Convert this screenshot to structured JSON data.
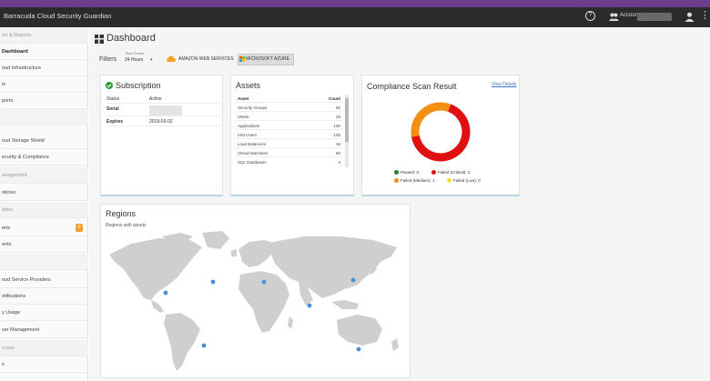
{
  "window": {
    "app_title": "Barracuda Cloud Security Guardian",
    "account_label": "Account",
    "help_icon": "question-circle-icon",
    "account_icon": "users-icon",
    "user_icon": "user-icon",
    "menu_icon": "kebab-menu-icon",
    "colors": {
      "accent_strip": "#6b3d8f",
      "topbar": "#2b2b2b"
    }
  },
  "sidebar": {
    "items": [
      {
        "label": "ert & Reports",
        "header": true
      },
      {
        "label": "Dashboard",
        "active": true
      },
      {
        "label": "oud Infrastructure"
      },
      {
        "label": "ts"
      },
      {
        "label": "ports"
      },
      {
        "label": "",
        "header": true
      },
      {
        "label": "oud Storage Shield"
      },
      {
        "label": "ecurity & Compliance"
      },
      {
        "label": "anagement",
        "header": true
      },
      {
        "label": "olicies"
      },
      {
        "label": "ation",
        "header": true
      },
      {
        "label": "erts",
        "badge": "0"
      },
      {
        "label": "ents"
      },
      {
        "label": "",
        "header": true
      },
      {
        "label": "oud Service Providers"
      },
      {
        "label": "otifications"
      },
      {
        "label": "y Usage"
      },
      {
        "label": "ser Management"
      },
      {
        "label": "ccess",
        "header": true
      },
      {
        "label": "s"
      }
    ]
  },
  "dashboard": {
    "title": "Dashboard",
    "filters_label": "Filters",
    "timeframe_caption": "Time Frame",
    "timeframe_value": "24 Hours",
    "aws_label": "AMAZON WEB SERVICES",
    "azure_label": "MICROSOFT AZURE"
  },
  "subscription": {
    "title": "Subscription",
    "status_icon": "check-circle-icon",
    "rows": [
      {
        "key": "Status",
        "value": "Active"
      },
      {
        "key": "Serial",
        "value": ""
      },
      {
        "key": "Expires",
        "value": "2019-03-02"
      }
    ]
  },
  "assets": {
    "title": "Assets",
    "header": {
      "name": "Asset",
      "count": "Count"
    },
    "rows": [
      {
        "name": "Security Groups",
        "count": "92"
      },
      {
        "name": "VNets",
        "count": "29"
      },
      {
        "name": "Applications",
        "count": "100"
      },
      {
        "name": "IAM Users",
        "count": "100"
      },
      {
        "name": "Load Balancers",
        "count": "16"
      },
      {
        "name": "Virtual Machines",
        "count": "50"
      },
      {
        "name": "SQL Databases",
        "count": "4"
      }
    ]
  },
  "compliance": {
    "title": "Compliance Scan Result",
    "view_details": "View Details",
    "chart_data": {
      "type": "pie",
      "categories": [
        "Passed",
        "Failed (Critical)",
        "Failed (Medium)",
        "Failed (Low)"
      ],
      "values": [
        0,
        2,
        1,
        0
      ],
      "colors": [
        "#2e7d32",
        "#e01010",
        "#f39012",
        "#f2e030"
      ]
    },
    "legend": [
      {
        "label": "Passed: 0",
        "color": "#2e7d32"
      },
      {
        "label": "Failed (Critical): 2",
        "color": "#e01010"
      },
      {
        "label": "Failed (Medium): 1",
        "color": "#f39012"
      },
      {
        "label": "Failed (Low): 0",
        "color": "#f2e030"
      }
    ]
  },
  "regions": {
    "title": "Regions",
    "subtitle": "Regions with assets",
    "marker_color": "#4a90d9"
  }
}
